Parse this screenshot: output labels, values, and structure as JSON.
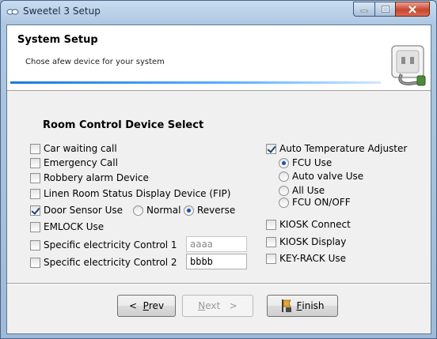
{
  "window": {
    "title": "Sweetel 3 Setup"
  },
  "header": {
    "title": "System Setup",
    "subtitle": "Chose afew device for your system",
    "image_icon": "setup-plug-icon"
  },
  "section": {
    "title": "Room Control Device Select"
  },
  "left_options": [
    {
      "label": "Car waiting call",
      "checked": false
    },
    {
      "label": "Emergency Call",
      "checked": false
    },
    {
      "label": "Robbery alarm Device",
      "checked": false
    },
    {
      "label": "Linen Room Status Display Device (FIP)",
      "checked": false
    },
    {
      "label": "Door Sensor Use",
      "checked": true
    },
    {
      "label": "EMLOCK Use",
      "checked": false
    },
    {
      "label": "Specific electricity Control 1",
      "checked": false
    },
    {
      "label": "Specific electricity Control 2",
      "checked": false
    }
  ],
  "door_sensor_modes": [
    {
      "label": "Normal",
      "selected": false
    },
    {
      "label": "Reverse",
      "selected": true
    }
  ],
  "control_inputs": {
    "control1_value": "aaaa",
    "control2_value": "bbbb"
  },
  "auto_temp": {
    "label": "Auto Temperature Adjuster",
    "checked": true
  },
  "temp_modes": [
    {
      "label": "FCU Use",
      "selected": true
    },
    {
      "label": "Auto valve Use",
      "selected": false
    },
    {
      "label": "All Use",
      "selected": false
    },
    {
      "label": "FCU ON/OFF",
      "selected": false
    }
  ],
  "right_options": [
    {
      "label": "KIOSK Connect",
      "checked": false
    },
    {
      "label": "KIOSK Display",
      "checked": false
    },
    {
      "label": "KEY-RACK Use",
      "checked": false
    }
  ],
  "buttons": {
    "prev_arrow": "<",
    "prev_mnemonic": "P",
    "prev_rest": "rev",
    "next_mnemonic": "N",
    "next_rest": "ext",
    "next_arrow": ">",
    "finish_mnemonic": "F",
    "finish_rest": "inish"
  }
}
